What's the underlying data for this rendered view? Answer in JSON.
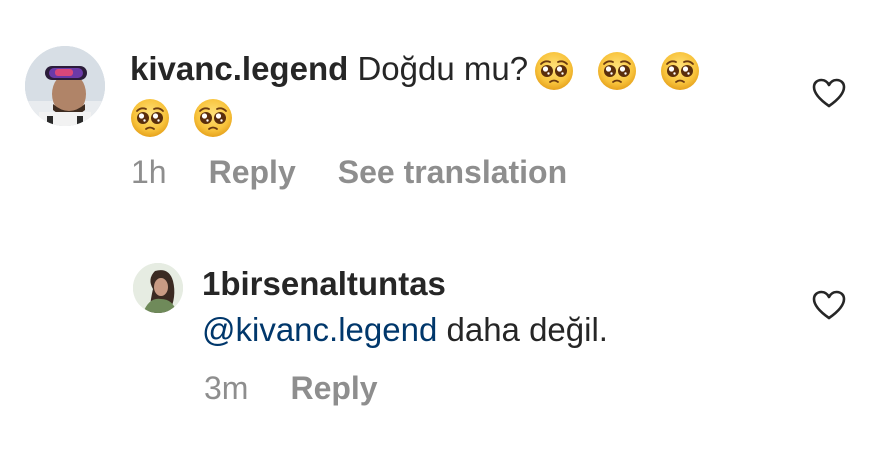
{
  "comments": [
    {
      "username": "kivanc.legend",
      "text": "Doğdu mu?",
      "emojis": [
        "pleading-face",
        "pleading-face",
        "pleading-face",
        "pleading-face",
        "pleading-face"
      ],
      "time": "1h",
      "reply_label": "Reply",
      "translate_label": "See translation"
    },
    {
      "username": "1birsenaltuntas",
      "mention": "@kivanc.legend",
      "text": "daha değil.",
      "time": "3m",
      "reply_label": "Reply"
    }
  ],
  "colors": {
    "text": "#262626",
    "secondary": "#8e8e8e",
    "mention": "#00376b"
  },
  "icons": {
    "like": "heart-outline-icon",
    "emoji": "pleading-face"
  }
}
